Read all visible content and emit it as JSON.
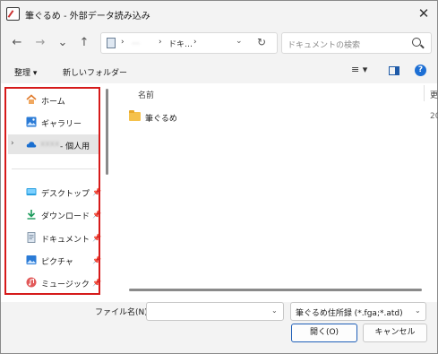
{
  "window": {
    "title": "筆ぐるめ - 外部データ読み込み",
    "close_glyph": "✕"
  },
  "nav": {
    "back": "←",
    "forward": "→",
    "recent": "⌄",
    "up": "↑",
    "address": {
      "seg1": "…",
      "seg2": "ドキ…",
      "sep": "›",
      "dropdown": "⌄",
      "refresh": "↻"
    },
    "search_placeholder": "ドキュメントの検索"
  },
  "toolbar": {
    "organize_label": "整理 ▾",
    "new_folder_label": "新しいフォルダー",
    "view_glyph": "≡ ▾",
    "help_glyph": "?"
  },
  "sidebar": {
    "items": [
      {
        "label": "ホーム",
        "icon": "home-icon"
      },
      {
        "label": "ギャラリー",
        "icon": "gallery-icon"
      },
      {
        "label": "- 個人用",
        "icon": "cloud-icon",
        "selected": true
      },
      {
        "label": "デスクトップ",
        "icon": "desktop-icon",
        "pinned": true
      },
      {
        "label": "ダウンロード",
        "icon": "download-icon",
        "pinned": true
      },
      {
        "label": "ドキュメント",
        "icon": "document-icon",
        "pinned": true
      },
      {
        "label": "ピクチャ",
        "icon": "pictures-icon",
        "pinned": true
      },
      {
        "label": "ミュージック",
        "icon": "music-icon",
        "pinned": true
      }
    ],
    "highlight_color": "#d61a1a"
  },
  "filelist": {
    "columns": {
      "name": "名前",
      "date": "更"
    },
    "rows": [
      {
        "name": "筆ぐるめ",
        "date": "20"
      }
    ]
  },
  "footer": {
    "filename_label": "ファイル名(N):",
    "filename_value": "",
    "filter_value": "筆ぐるめ住所録 (*.fga;*.atd)",
    "open_label": "開く(O)",
    "cancel_label": "キャンセル"
  }
}
